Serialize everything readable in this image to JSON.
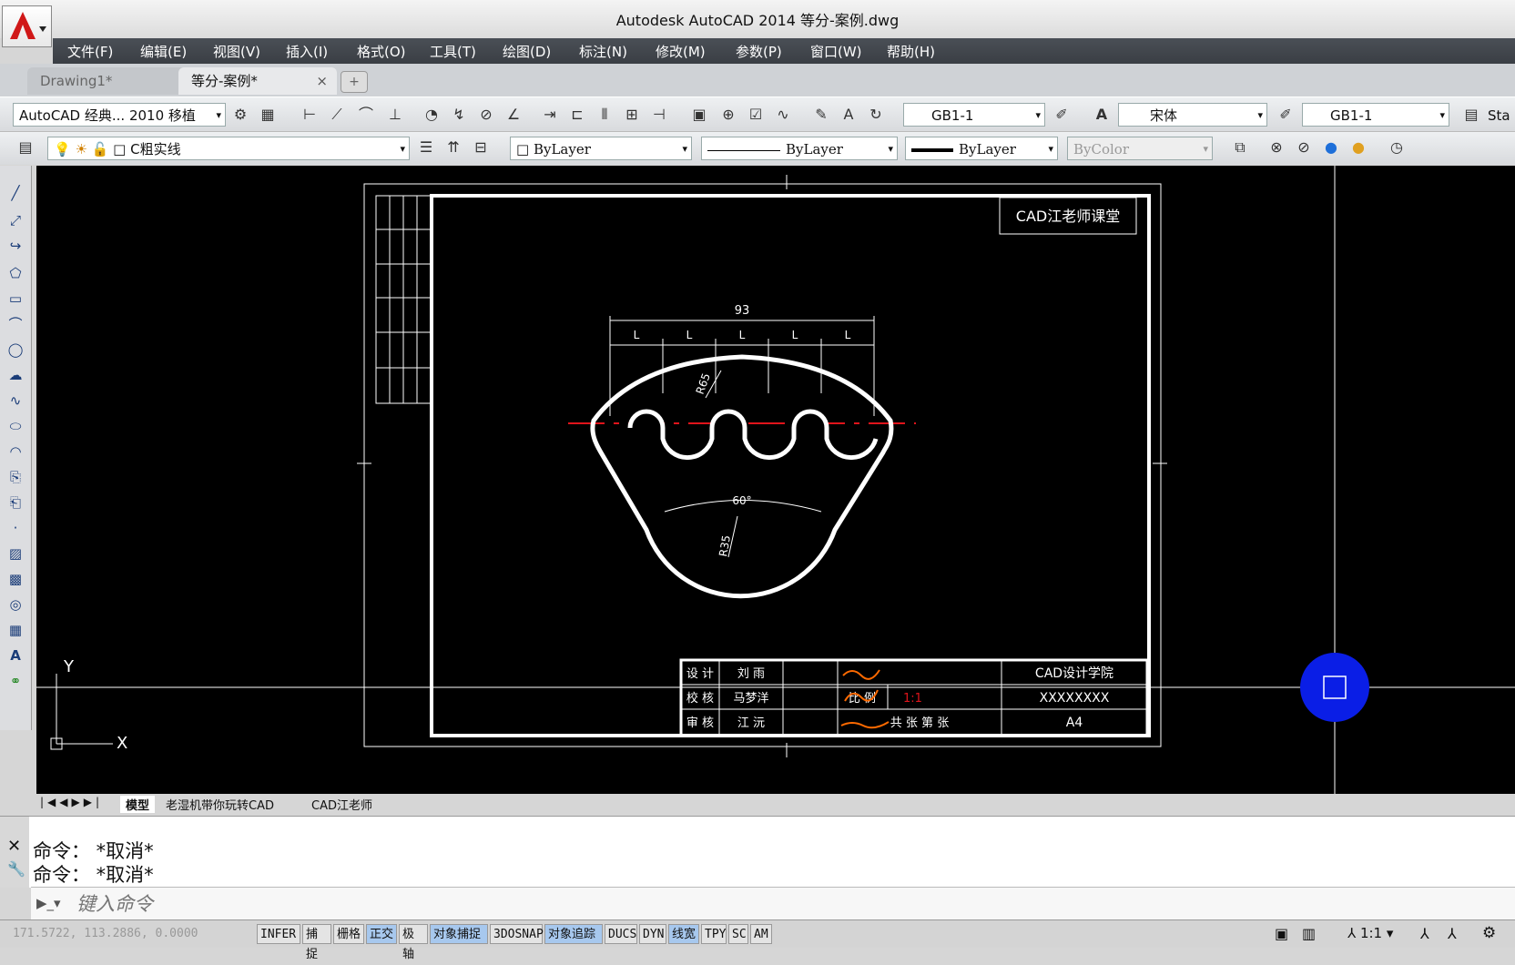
{
  "titlebar": {
    "title": "Autodesk AutoCAD 2014      等分-案例.dwg"
  },
  "menu": [
    "文件(F)",
    "编辑(E)",
    "视图(V)",
    "插入(I)",
    "格式(O)",
    "工具(T)",
    "绘图(D)",
    "标注(N)",
    "修改(M)",
    "参数(P)",
    "窗口(W)",
    "帮助(H)"
  ],
  "doc_tabs": {
    "tab1": "Drawing1*",
    "tab2": "等分-案例*",
    "close": "×"
  },
  "toolbar1": {
    "workspace": "AutoCAD 经典... 2010 移植",
    "dimstyle": "GB1-1",
    "textstyle_icon": "text-style-icon",
    "font": "宋体",
    "multileader": "GB1-1",
    "table_style": "Sta"
  },
  "toolbar2": {
    "layer": "C粗实线",
    "color": "ByLayer",
    "linetype": "ByLayer",
    "lineweight": "ByLayer",
    "plotstyle": "ByColor"
  },
  "drawing": {
    "corner_label": "CAD江老师课堂",
    "dim_total": "93",
    "dim_seg": "L",
    "radius1": "R65",
    "angle": "60°",
    "radius2": "R35",
    "titleblock": {
      "row1": [
        "设 计",
        "刘 雨",
        "",
        "",
        "CAD设计学院"
      ],
      "row2": [
        "校 核",
        "马梦洋",
        "",
        "比 例",
        "1:1",
        "XXXXXXXX"
      ],
      "row3": [
        "审 核",
        "江 沅",
        "",
        "共 张 第 张",
        "A4"
      ]
    },
    "ucs": {
      "x": "X",
      "y": "Y"
    }
  },
  "layout_tabs": [
    "模型",
    "老湿机带你玩转CAD",
    "CAD江老师"
  ],
  "command_history": [
    "命令：  *取消*",
    "命令：  *取消*"
  ],
  "command_placeholder": "键入命令",
  "status": {
    "coords": "171.5722, 113.2886, 0.0000",
    "buttons": [
      "INFER",
      "捕捉",
      "栅格",
      "正交",
      "极轴",
      "对象捕捉",
      "3DOSNAP",
      "对象追踪",
      "DUCS",
      "DYN",
      "线宽",
      "TPY",
      "SC",
      "AM"
    ],
    "on": [
      "正交",
      "对象捕捉",
      "对象追踪",
      "线宽"
    ],
    "scale": "1:1"
  },
  "colors": {
    "accent": "#4a4f56",
    "canvas": "#000000",
    "red_axis": "#e0141b",
    "orange_sign": "#ff6a00"
  }
}
